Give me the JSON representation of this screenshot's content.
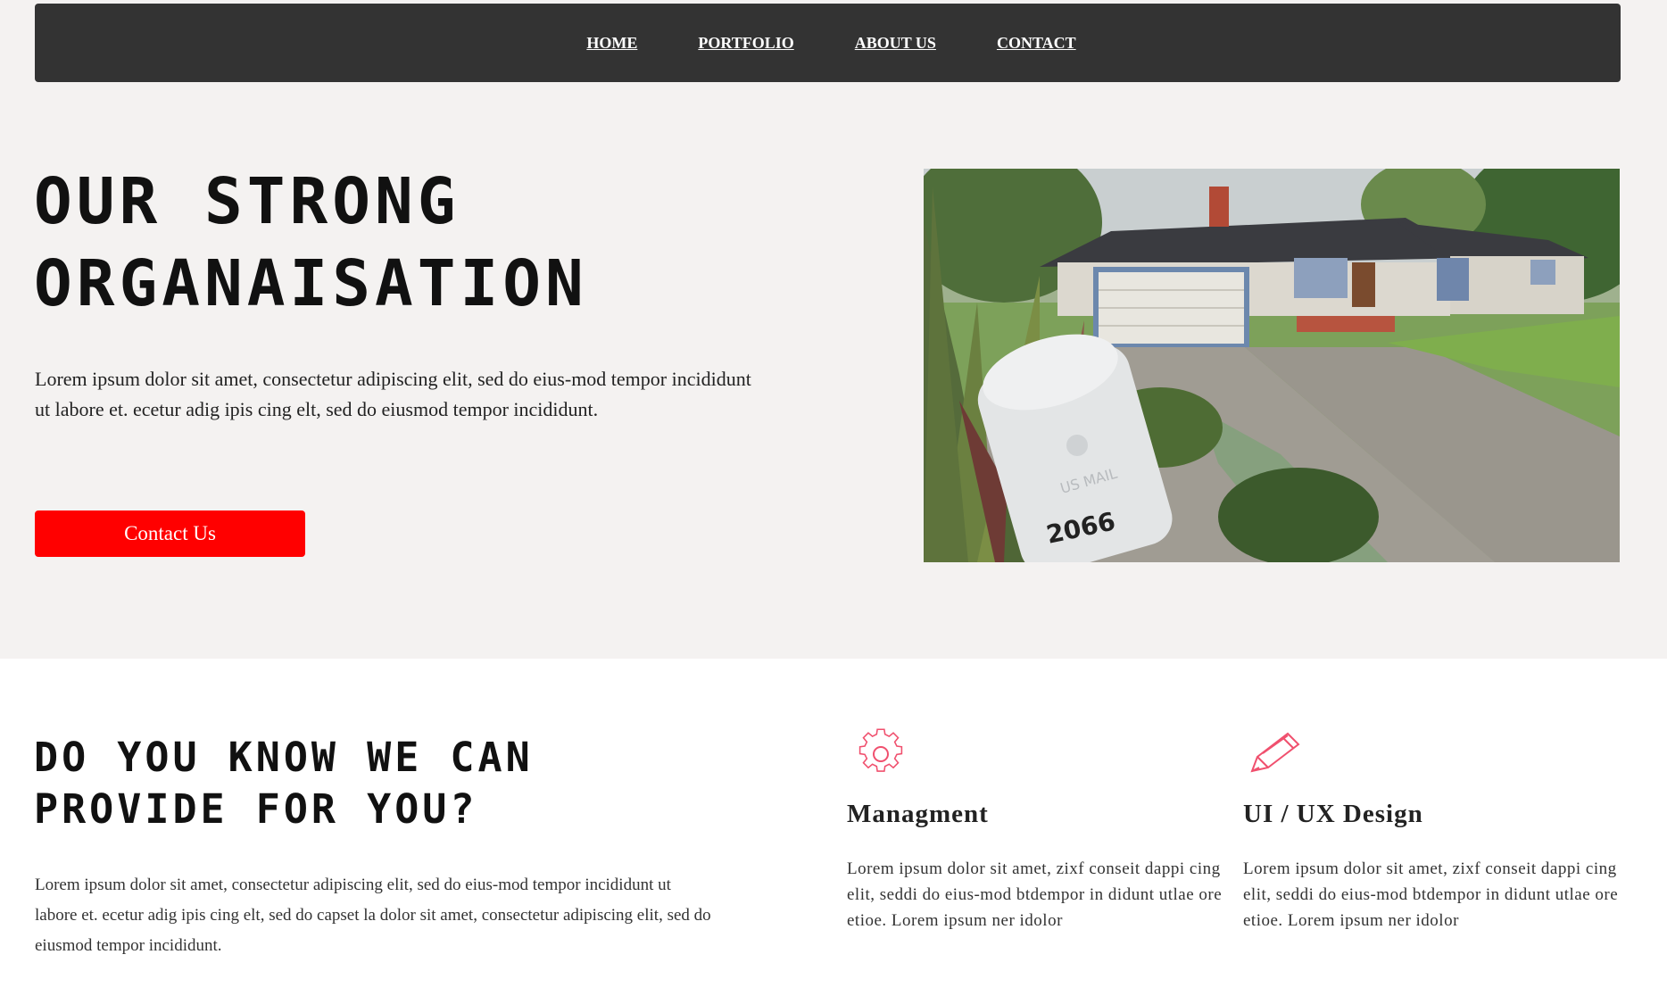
{
  "nav": {
    "items": [
      {
        "label": "HOME"
      },
      {
        "label": "PORTFOLIO"
      },
      {
        "label": "ABOUT US"
      },
      {
        "label": "CONTACT"
      }
    ]
  },
  "hero": {
    "title_line1": "OUR STRONG",
    "title_line2": "ORGANAISATION",
    "text": "Lorem ipsum dolor sit amet, consectetur adipiscing elit, sed do eius-mod tempor incididunt ut labore et. ecetur adig ipis cing elt, sed do eiusmod tempor incididunt.",
    "button_label": "Contact Us",
    "image_mailbox_number": "2066",
    "image_mailbox_text": "US MAIL"
  },
  "services_section": {
    "title_line1": "DO YOU KNOW WE CAN",
    "title_line2": "PROVIDE FOR YOU?",
    "text": "Lorem ipsum dolor sit amet, consectetur adipiscing elit, sed do eius-mod tempor incididunt ut labore et. ecetur adig ipis cing elt, sed do capset la dolor sit amet, consectetur adipiscing elit, sed do eiusmod tempor incididunt.",
    "items": [
      {
        "icon": "gear-icon",
        "title": "Managment",
        "text": "Lorem ipsum dolor sit amet, zixf conseit dappi cing elit, seddi do eius-mod btdempor in didunt utlae ore etioe. Lorem ipsum ner idolor"
      },
      {
        "icon": "pencil-icon",
        "title": "UI / UX Design",
        "text": "Lorem ipsum dolor sit amet, zixf conseit dappi cing elit, seddi do eius-mod btdempor in didunt utlae ore etioe. Lorem ipsum ner idolor"
      }
    ]
  },
  "colors": {
    "nav_bg": "#333333",
    "hero_bg": "#f4f2f1",
    "accent": "#ff0000",
    "icon_stroke": "#f0506e"
  }
}
